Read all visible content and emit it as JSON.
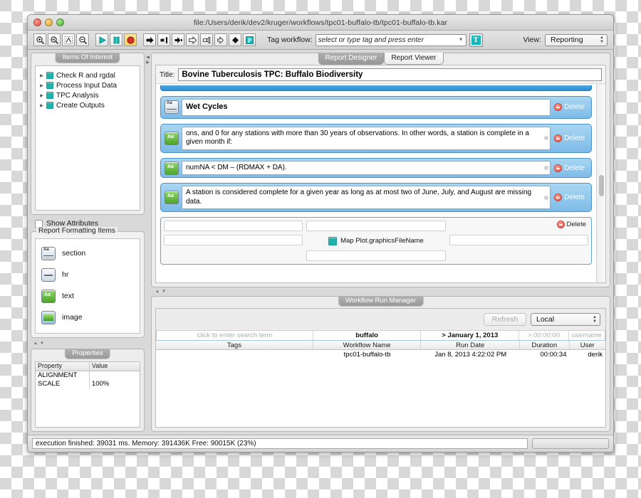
{
  "window": {
    "title": "file:/Users/derik/dev2/kruger/workflows/tpc01-buffalo-tb/tpc01-buffalo-tb.kar"
  },
  "toolbar": {
    "icons": [
      {
        "name": "zoom-in-icon",
        "glyph": "zoom-in"
      },
      {
        "name": "zoom-reset-icon",
        "glyph": "zoom-back"
      },
      {
        "name": "zoom-fit-icon",
        "glyph": "fit"
      },
      {
        "name": "zoom-out-icon",
        "glyph": "zoom-out"
      },
      {
        "name": "run-icon",
        "glyph": "play"
      },
      {
        "name": "pause-icon",
        "glyph": "pause"
      },
      {
        "name": "stop-icon",
        "glyph": "stop"
      },
      {
        "name": "arrow-right-filled-icon",
        "glyph": "arrow-filled"
      },
      {
        "name": "flag-filled-icon",
        "glyph": "flag-filled"
      },
      {
        "name": "step-filled-icon",
        "glyph": "step-filled"
      },
      {
        "name": "arrow-right-outline-icon",
        "glyph": "arrow-outline"
      },
      {
        "name": "flag-outline-icon",
        "glyph": "flag-outline"
      },
      {
        "name": "step-outline-icon",
        "glyph": "step-outline"
      },
      {
        "name": "diamond-icon",
        "glyph": "diamond"
      },
      {
        "name": "provenance-icon",
        "glyph": "p-badge"
      }
    ],
    "tag_label": "Tag workflow:",
    "tag_placeholder": "select or type tag and press enter",
    "tag_button": "T",
    "view_label": "View:",
    "view_value": "Reporting"
  },
  "sidebar": {
    "items_of_interest": {
      "title": "Items Of Interest",
      "nodes": [
        {
          "label": "Check R and rgdal"
        },
        {
          "label": "Process Input Data"
        },
        {
          "label": "TPC Analysis"
        },
        {
          "label": "Create Outputs"
        }
      ]
    },
    "show_attributes_label": "Show Attributes",
    "formatting": {
      "title": "Report Formatting Items",
      "items": [
        {
          "label": "section",
          "icon": "section-icon"
        },
        {
          "label": "hr",
          "icon": "hr-icon"
        },
        {
          "label": "text",
          "icon": "text-icon"
        },
        {
          "label": "image",
          "icon": "image-icon"
        }
      ]
    },
    "properties": {
      "title": "Properties",
      "columns": [
        "Property",
        "Value"
      ],
      "rows": [
        {
          "property": "ALIGNMENT",
          "value": ""
        },
        {
          "property": "SCALE",
          "value": "100%"
        }
      ]
    }
  },
  "designer": {
    "tabs": [
      {
        "label": "Report Designer",
        "selected": true
      },
      {
        "label": "Report Viewer",
        "selected": false
      }
    ],
    "title_label": "Title:",
    "title_value": "Bovine Tuberculosis TPC: Buffalo Biodiversity",
    "delete_label": "Delete",
    "rows": [
      {
        "type": "section",
        "icon": "section-icon",
        "text": "Wet Cycles"
      },
      {
        "type": "text",
        "icon": "text-icon",
        "text": "ons, and 0 for any stations with more than 30 years of observations. In other words, a station is complete in a given month if:"
      },
      {
        "type": "text",
        "icon": "text-icon",
        "text": "numNA < DM – (RDMAX + DA)."
      },
      {
        "type": "text",
        "icon": "text-icon",
        "text": "A station is considered complete for a given year as long as at most two of June, July, and August are missing data."
      }
    ],
    "image_row": {
      "label": "Map Plot.graphicsFileName",
      "icon": "port-icon",
      "delete_label": "Delete"
    }
  },
  "run_manager": {
    "title": "Workflow Run Manager",
    "refresh_label": "Refresh",
    "scope_value": "Local",
    "filters": {
      "tags": "click to enter search term",
      "workflow_name": "buffalo",
      "run_date": "> January 1, 2013",
      "duration": "> 00:00:00",
      "user": "username"
    },
    "columns": [
      "Tags",
      "Workflow Name",
      "Run Date",
      "Duration",
      "User"
    ],
    "rows": [
      {
        "tags": "",
        "workflow_name": "tpc01-buffalo-tb",
        "run_date": "Jan 8, 2013 4:22:02 PM",
        "duration": "00:00:34",
        "user": "derik"
      }
    ]
  },
  "status": {
    "message": "execution finished: 39031 ms. Memory: 391436K Free: 90015K (23%)"
  },
  "colors": {
    "accent_teal": "#22b2ac",
    "row_blue": "#7dbbe8",
    "delete_red": "#e0564a",
    "text_green": "#4fa32c"
  }
}
